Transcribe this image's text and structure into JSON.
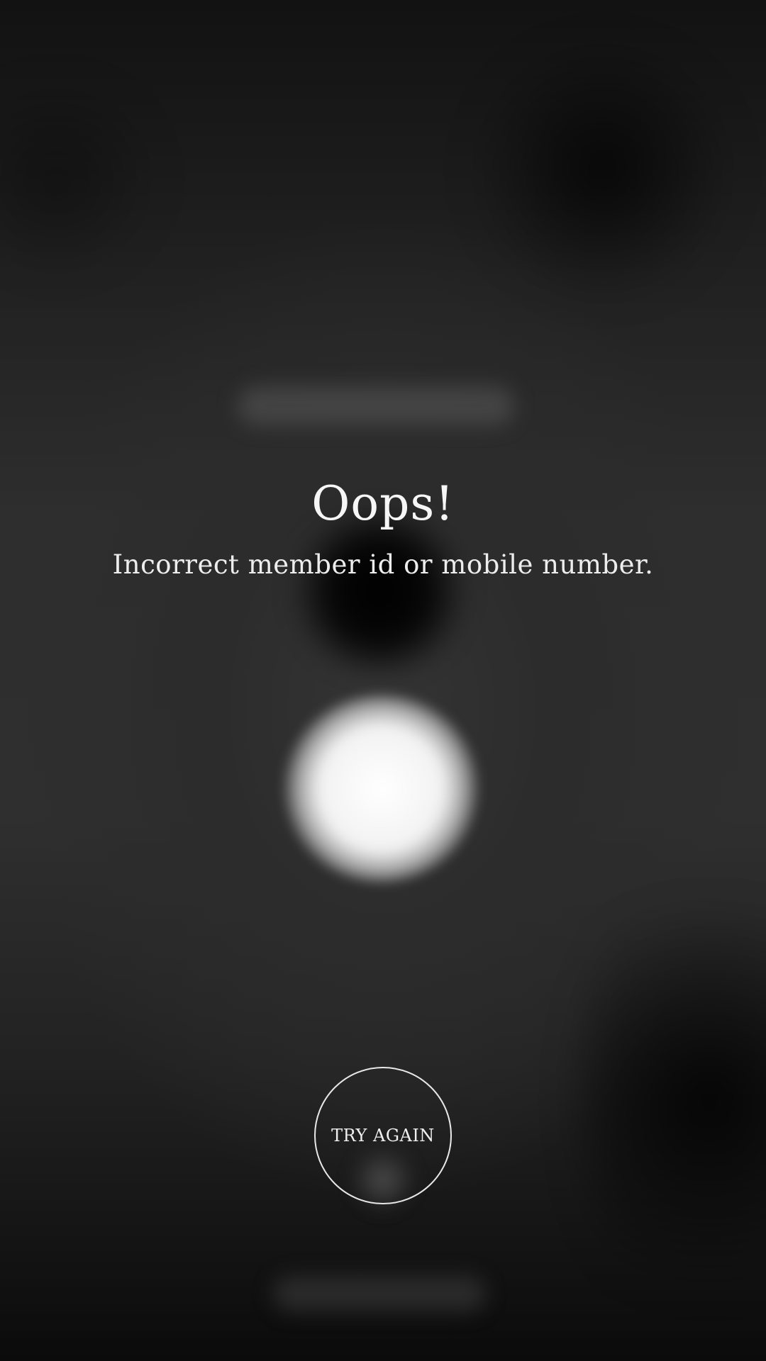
{
  "error": {
    "title": "Oops!",
    "message": "Incorrect member id or mobile number."
  },
  "actions": {
    "retry_label": "TRY AGAIN"
  },
  "colors": {
    "background": "#2e2e2e",
    "text": "#f4f4f4",
    "button_border": "#e8e8e8"
  }
}
